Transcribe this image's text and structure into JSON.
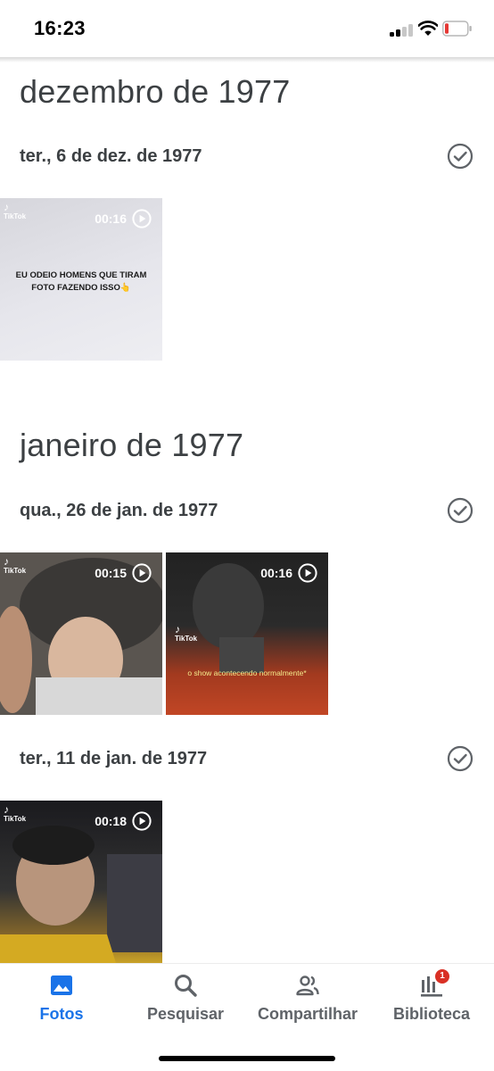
{
  "status_bar": {
    "time": "16:23",
    "battery_color": "#e53935"
  },
  "sections": [
    {
      "month": "dezembro de 1977",
      "days": [
        {
          "date": "ter., 6 de dez. de 1977",
          "items": [
            {
              "duration": "00:16",
              "tiktok_label": "TikTok",
              "caption": "EU ODEIO HOMENS QUE TIRAM FOTO FAZENDO ISSO👆"
            }
          ]
        }
      ]
    },
    {
      "month": "janeiro de 1977",
      "days": [
        {
          "date": "qua., 26 de jan. de 1977",
          "items": [
            {
              "duration": "00:15",
              "tiktok_label": "TikTok"
            },
            {
              "duration": "00:16",
              "tiktok_label": "TikTok",
              "caption": "o show acontecendo normalmente*"
            }
          ]
        },
        {
          "date": "ter., 11 de jan. de 1977",
          "items": [
            {
              "duration": "00:18",
              "tiktok_label": "TikTok"
            }
          ]
        }
      ]
    }
  ],
  "nav": {
    "accent_color": "#1a73e8",
    "items": [
      {
        "label": "Fotos",
        "icon": "photo-icon",
        "active": true
      },
      {
        "label": "Pesquisar",
        "icon": "search-icon"
      },
      {
        "label": "Compartilhar",
        "icon": "people-icon"
      },
      {
        "label": "Biblioteca",
        "icon": "library-icon",
        "badge": "1"
      }
    ]
  }
}
